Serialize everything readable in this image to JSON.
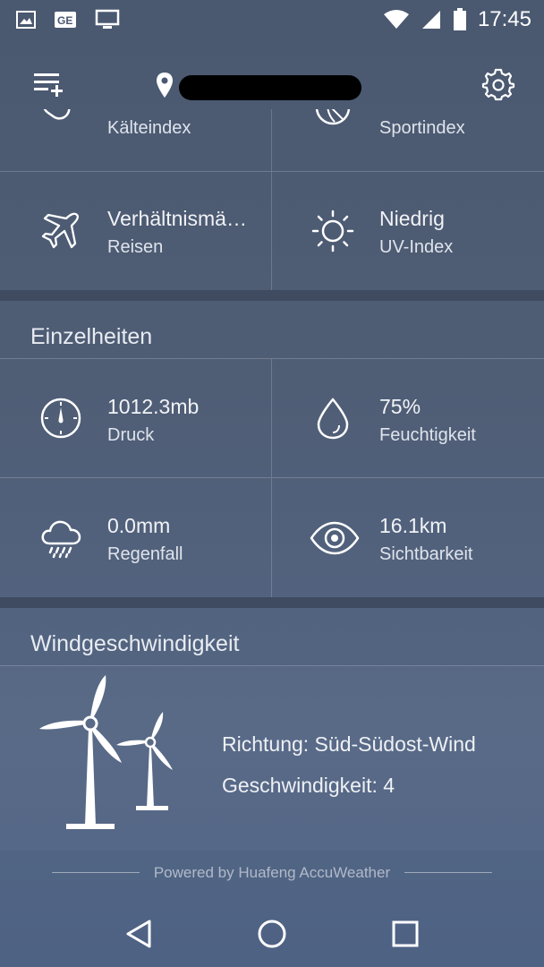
{
  "status_bar": {
    "time": "17:45",
    "icons": [
      "image-icon",
      "gallery-ge-icon",
      "cast-screen-icon",
      "wifi-icon",
      "signal-icon",
      "battery-icon"
    ]
  },
  "app_bar": {
    "menu_icon": "playlist-add-icon",
    "location_icon": "location-pin-icon",
    "location_text_redacted": true,
    "settings_icon": "gear-icon"
  },
  "indices": [
    {
      "value": "",
      "label": "Kälteindex",
      "icon": "cold-index-icon"
    },
    {
      "value": "",
      "label": "Sportindex",
      "icon": "ball-icon"
    },
    {
      "value": "Verhältnismä…",
      "label": "Reisen",
      "icon": "airplane-icon"
    },
    {
      "value": "Niedrig",
      "label": "UV-Index",
      "icon": "sun-icon"
    }
  ],
  "details": {
    "title": "Einzelheiten",
    "items": [
      {
        "value": "1012.3mb",
        "label": "Druck",
        "icon": "gauge-icon"
      },
      {
        "value": "75%",
        "label": "Feuchtigkeit",
        "icon": "drop-icon"
      },
      {
        "value": "0.0mm",
        "label": "Regenfall",
        "icon": "rain-cloud-icon"
      },
      {
        "value": "16.1km",
        "label": "Sichtbarkeit",
        "icon": "eye-icon"
      }
    ]
  },
  "wind": {
    "title": "Windgeschwindigkeit",
    "direction": "Richtung: Süd-Südost-Wind",
    "speed": "Geschwindigkeit: 4",
    "icon": "wind-turbine-icon"
  },
  "footer": {
    "powered_by": "Powered by Huafeng AccuWeather"
  },
  "nav": {
    "back_icon": "back-triangle-icon",
    "home_icon": "home-circle-icon",
    "recents_icon": "recents-square-icon"
  },
  "colors": {
    "background": "#4f5d75",
    "divider": "#3e4b60",
    "text": "#ffffff"
  }
}
